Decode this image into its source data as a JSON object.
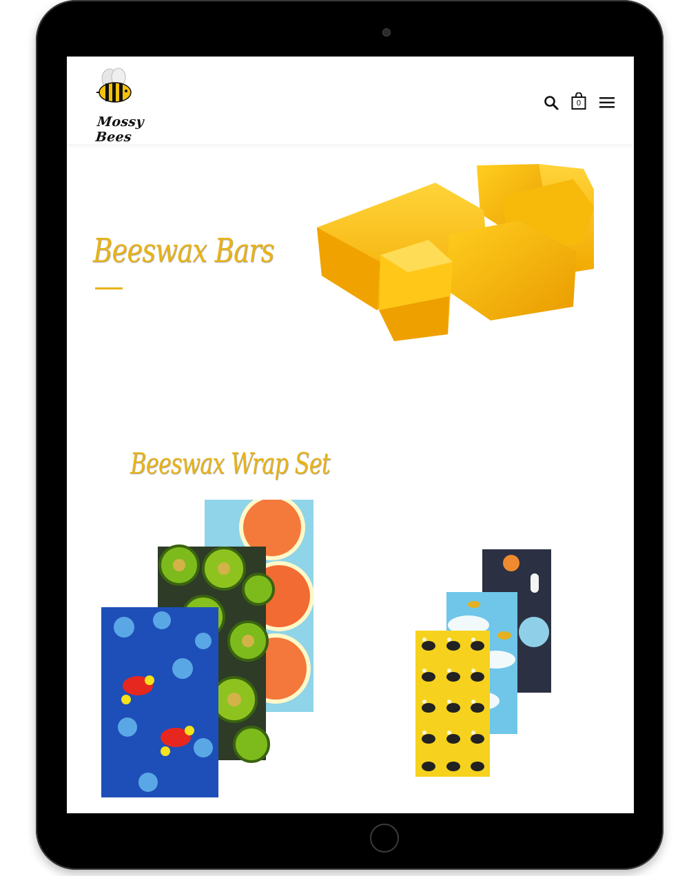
{
  "brand": {
    "name": "Mossy Bees",
    "accent_color": "#e8b316"
  },
  "header": {
    "icons": [
      "search-icon",
      "cart-icon",
      "menu-icon"
    ],
    "cart_count": "0"
  },
  "sections": [
    {
      "title": "Beeswax Bars",
      "image": "beeswax-bars-image"
    },
    {
      "title": "Beeswax Wrap Set",
      "images": [
        "wrap-set-fruit-image",
        "wrap-set-bees-image"
      ]
    }
  ]
}
